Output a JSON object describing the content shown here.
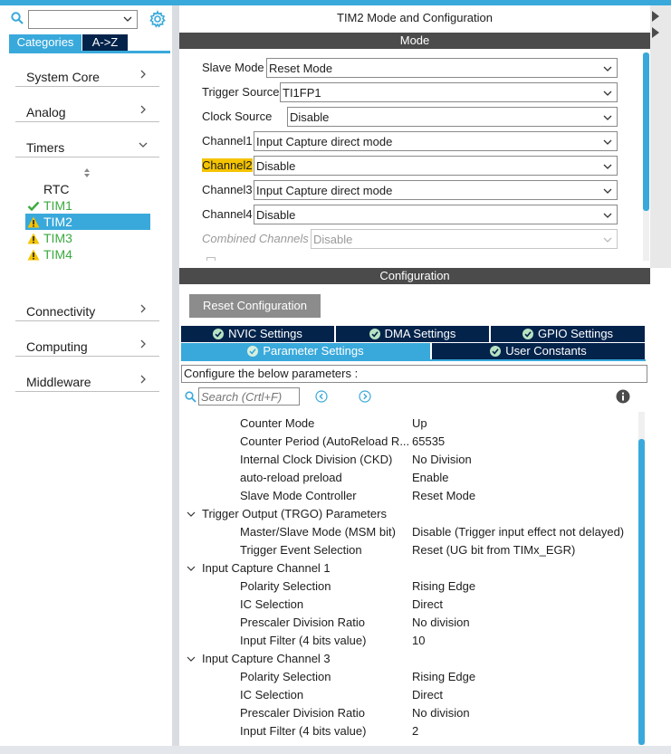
{
  "colors": {
    "accent": "#39a9db",
    "navy": "#03234b",
    "warning": "#f5c400",
    "ok": "#3bab3e"
  },
  "left": {
    "tabs": [
      {
        "label": "Categories"
      },
      {
        "label": "A->Z"
      }
    ],
    "categories": [
      {
        "label": "System Core"
      },
      {
        "label": "Analog"
      },
      {
        "label": "Timers"
      },
      {
        "label": "Connectivity"
      },
      {
        "label": "Computing"
      },
      {
        "label": "Middleware"
      }
    ],
    "timers": [
      {
        "label": "RTC",
        "status": "none"
      },
      {
        "label": "TIM1",
        "status": "ok"
      },
      {
        "label": "TIM2",
        "status": "warning"
      },
      {
        "label": "TIM3",
        "status": "warning"
      },
      {
        "label": "TIM4",
        "status": "warning"
      }
    ]
  },
  "right": {
    "title": "TIM2 Mode and Configuration",
    "mode_header": "Mode",
    "mode_rows": [
      {
        "label": "Slave Mode",
        "value": "Reset Mode"
      },
      {
        "label": "Trigger Source",
        "value": "TI1FP1"
      },
      {
        "label": "Clock Source",
        "value": "Disable"
      },
      {
        "label": "Channel1",
        "value": "Input Capture direct mode"
      },
      {
        "label": "Channel2",
        "value": "Disable"
      },
      {
        "label": "Channel3",
        "value": "Input Capture direct mode"
      },
      {
        "label": "Channel4",
        "value": "Disable"
      },
      {
        "label": "Combined Channels",
        "value": "Disable"
      }
    ],
    "config_header": "Configuration",
    "reset_button": "Reset Configuration",
    "tabs_row1": [
      {
        "label": "NVIC Settings"
      },
      {
        "label": "DMA Settings"
      },
      {
        "label": "GPIO Settings"
      }
    ],
    "tabs_row2": [
      {
        "label": "Parameter Settings"
      },
      {
        "label": "User Constants"
      }
    ],
    "hint": "Configure the below parameters :",
    "search_placeholder": "Search (Crtl+F)",
    "params": [
      {
        "name": "Counter Mode",
        "value": "Up"
      },
      {
        "name": "Counter Period (AutoReload R...",
        "value": "65535"
      },
      {
        "name": "Internal Clock Division (CKD)",
        "value": "No Division"
      },
      {
        "name": "auto-reload preload",
        "value": "Enable"
      },
      {
        "name": "Slave Mode Controller",
        "value": "Reset Mode"
      }
    ],
    "groups": [
      {
        "title": "Trigger Output (TRGO) Parameters",
        "params": [
          {
            "name": "Master/Slave Mode (MSM bit)",
            "value": "Disable (Trigger input effect not delayed)"
          },
          {
            "name": "Trigger Event Selection",
            "value": "Reset (UG bit from TIMx_EGR)"
          }
        ]
      },
      {
        "title": "Input Capture Channel 1",
        "params": [
          {
            "name": "Polarity Selection",
            "value": "Rising Edge"
          },
          {
            "name": "IC Selection",
            "value": "Direct"
          },
          {
            "name": "Prescaler Division Ratio",
            "value": "No division"
          },
          {
            "name": "Input Filter (4 bits value)",
            "value": "10"
          }
        ]
      },
      {
        "title": "Input Capture Channel 3",
        "params": [
          {
            "name": "Polarity Selection",
            "value": "Rising Edge"
          },
          {
            "name": "IC Selection",
            "value": "Direct"
          },
          {
            "name": "Prescaler Division Ratio",
            "value": "No division"
          },
          {
            "name": "Input Filter (4 bits value)",
            "value": "2"
          }
        ]
      }
    ]
  }
}
